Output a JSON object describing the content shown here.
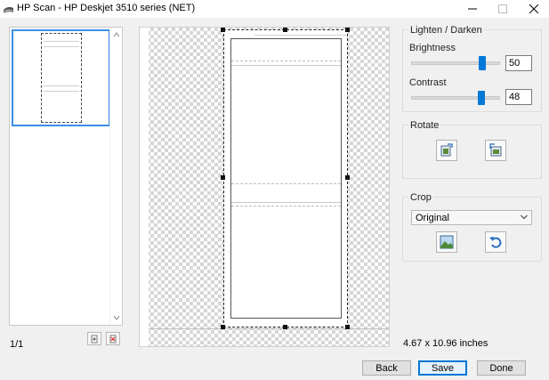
{
  "window": {
    "title": "HP Scan - HP Deskjet 3510 series (NET)",
    "minimize": "—",
    "maximize": "☐",
    "close": "✕"
  },
  "thumbnails": {
    "page_count": "1/1"
  },
  "preview": {
    "doc_text": "———————————————————————"
  },
  "lighten_darken": {
    "group_title": "Lighten / Darken",
    "brightness": {
      "label": "Brightness",
      "value": "50",
      "level": 0.5
    },
    "contrast": {
      "label": "Contrast",
      "value": "48",
      "level": 0.48
    }
  },
  "rotate": {
    "group_title": "Rotate"
  },
  "crop": {
    "group_title": "Crop",
    "selected_option": "Original"
  },
  "scan_size": "4.67 x 10.96 inches",
  "footer": {
    "back_label": "Back",
    "save_label": "Save",
    "done_label": "Done"
  },
  "colors": {
    "accent": "#0078d7",
    "selection": "#3a8ee6"
  }
}
